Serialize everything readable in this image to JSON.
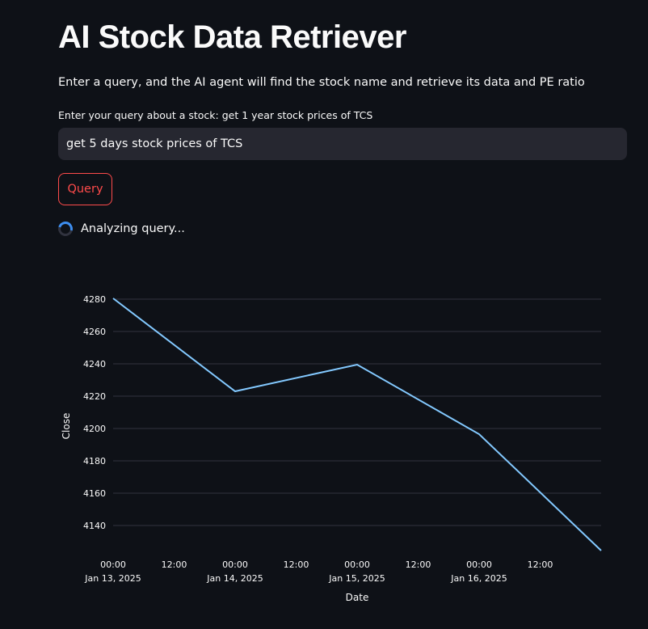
{
  "app": {
    "title": "AI Stock Data Retriever",
    "subtitle": "Enter a query, and the AI agent will find the stock name and retrieve its data and PE ratio"
  },
  "query_form": {
    "label": "Enter your query about a stock: get 1 year stock prices of TCS",
    "value": "get 5 days stock prices of TCS",
    "button_label": "Query"
  },
  "status": {
    "text": "Analyzing query..."
  },
  "colors": {
    "background": "#0e1117",
    "accent": "#ff4b4b",
    "input_bg": "#262730",
    "spinner": "#3d8ef0",
    "line": "#83c9ff",
    "grid": "#31333f"
  },
  "chart_data": {
    "type": "line",
    "xlabel": "Date",
    "ylabel": "Close",
    "ylim": [
      4123,
      4281
    ],
    "yticks": [
      4140,
      4160,
      4180,
      4200,
      4220,
      4240,
      4260,
      4280
    ],
    "xlim": [
      0,
      4
    ],
    "xticks": [
      {
        "x": 0,
        "line1": "00:00",
        "line2": "Jan 13, 2025"
      },
      {
        "x": 0.5,
        "line1": "12:00",
        "line2": ""
      },
      {
        "x": 1,
        "line1": "00:00",
        "line2": "Jan 14, 2025"
      },
      {
        "x": 1.5,
        "line1": "12:00",
        "line2": ""
      },
      {
        "x": 2,
        "line1": "00:00",
        "line2": "Jan 15, 2025"
      },
      {
        "x": 2.5,
        "line1": "12:00",
        "line2": ""
      },
      {
        "x": 3,
        "line1": "00:00",
        "line2": "Jan 16, 2025"
      },
      {
        "x": 3.5,
        "line1": "12:00",
        "line2": ""
      }
    ],
    "grid": "horizontal",
    "series": [
      {
        "x": [
          "Jan 13, 2025",
          "Jan 14, 2025",
          "Jan 15, 2025",
          "Jan 16, 2025",
          "Jan 17, 2025"
        ],
        "y": [
          4280.5,
          4223.0,
          4239.5,
          4196.5,
          4124.5
        ]
      }
    ]
  }
}
